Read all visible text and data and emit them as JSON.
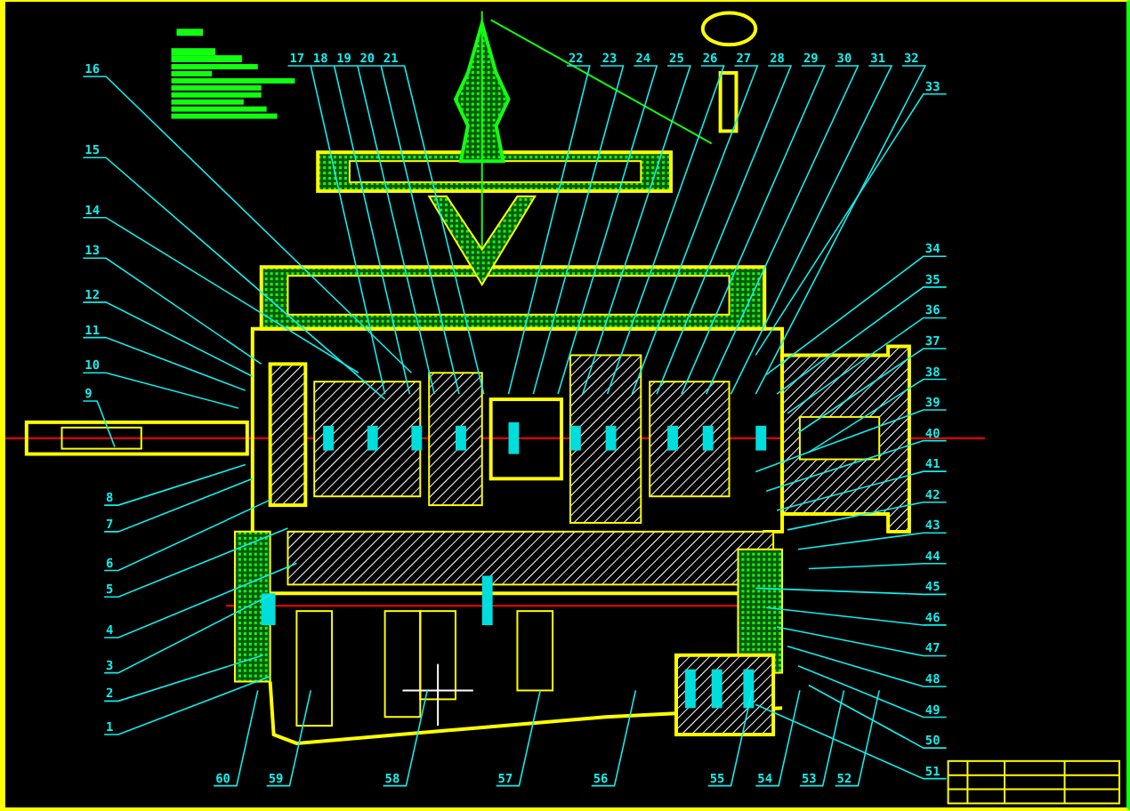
{
  "drawing": {
    "left_callouts": [
      "16",
      "15",
      "14",
      "13",
      "12",
      "11",
      "10",
      "9",
      "8",
      "7",
      "6",
      "5",
      "4",
      "3",
      "2",
      "1"
    ],
    "top_callouts": [
      "17",
      "18",
      "19",
      "20",
      "21",
      "22",
      "23",
      "24",
      "25",
      "26",
      "27",
      "28",
      "29",
      "30",
      "31",
      "32"
    ],
    "right_callouts": [
      "33",
      "34",
      "35",
      "36",
      "37",
      "38",
      "39",
      "40",
      "41",
      "42",
      "43",
      "44",
      "45",
      "46",
      "47",
      "48",
      "49",
      "50",
      "51"
    ],
    "bottom_callouts": [
      "60",
      "59",
      "58",
      "57",
      "56",
      "55",
      "54",
      "53",
      "52"
    ]
  }
}
